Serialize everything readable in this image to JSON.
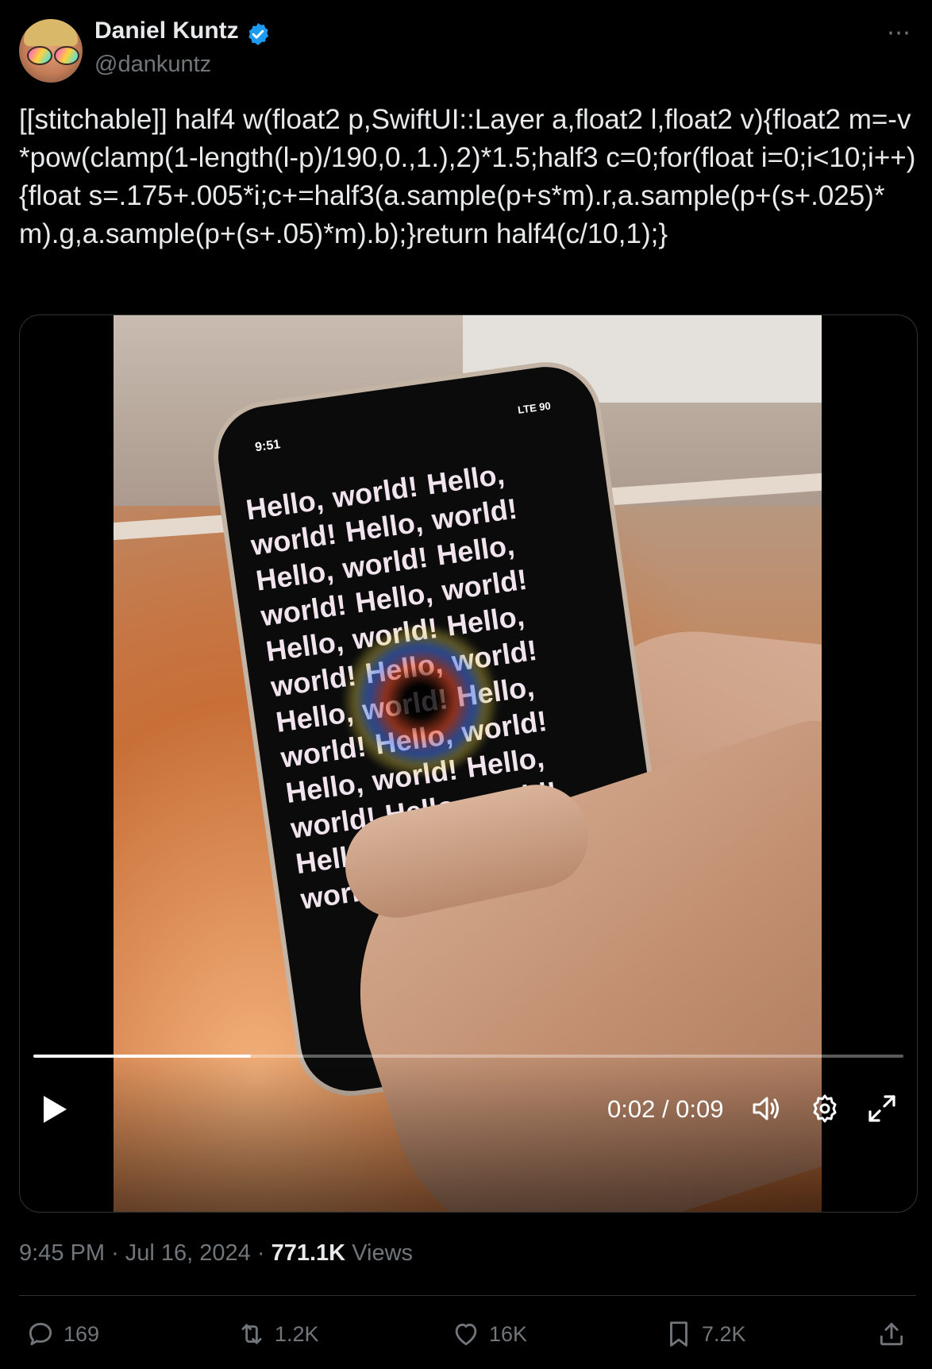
{
  "author": {
    "name": "Daniel Kuntz",
    "handle": "@dankuntz",
    "verified": true,
    "verified_color": "#1d9bf0"
  },
  "more_icon": "⋯",
  "tweet": {
    "text": "[[stitchable]] half4 w(float2 p,SwiftUI::Layer a,float2 l,float2 v){float2 m=-v*pow(clamp(1-length(l-p)/190,0.,1.),2)*1.5;half3 c=0;for(float i=0;i<10;i++){float s=.175+.005*i;c+=half3(a.sample(p+s*m).r,a.sample(p+(s+.025)*m).g,a.sample(p+(s+.05)*m).b);}return half4(c/10,1);}"
  },
  "video": {
    "phone_status_time": "9:51",
    "phone_status_right": "LTE 90",
    "phone_text": "Hello, world! Hello, world! Hello, world! Hello, world! Hello, world! Hello, world! Hello, world! Hello, world! Hello, world! Hello, world! Hello, world! Hello, world! Hello, world! Hello, world! Hello, world! Hello, world! Hello, world!",
    "progress_fraction": 0.25,
    "time_display": "0:02 / 0:09"
  },
  "meta": {
    "time": "9:45 PM",
    "separator": "·",
    "date": "Jul 16, 2024",
    "views_count": "771.1K",
    "views_label": "Views"
  },
  "actions": {
    "replies": "169",
    "reposts": "1.2K",
    "likes": "16K",
    "bookmarks": "7.2K"
  }
}
